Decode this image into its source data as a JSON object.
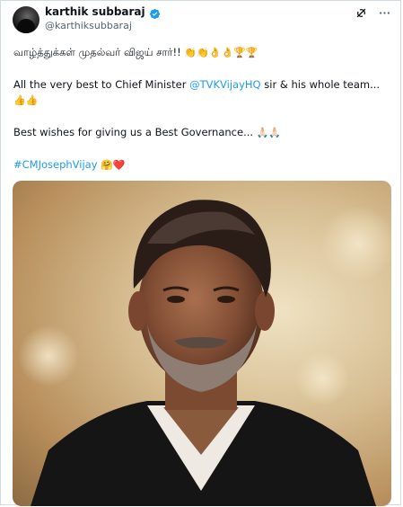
{
  "user": {
    "name": "karthik subbaraj",
    "handle": "@karthiksubbaraj"
  },
  "icons": {
    "verified": "verified-badge-icon",
    "grok": "grok-icon",
    "more": "more-options-icon"
  },
  "tweet": {
    "line1_text": "வாழ்த்துக்கள் முதல்வர் விஜய் சார்!!",
    "line1_emoji": "👏👏👌👌🏆🏆",
    "line2_prefix": "All the very best to Chief Minister ",
    "line2_mention": "@TVKVijayHQ",
    "line2_suffix": " sir & his whole team...",
    "line3_emoji": "👍👍",
    "line4_text": "Best wishes for giving us a Best Governance...",
    "line4_emoji": "🙏🏻🙏🏻",
    "hashtag": "#CMJosephVijay",
    "hashtag_emoji": "🤗❤️"
  },
  "colors": {
    "accent": "#1d9bf0",
    "text": "#0f1419",
    "secondary": "#536471"
  }
}
